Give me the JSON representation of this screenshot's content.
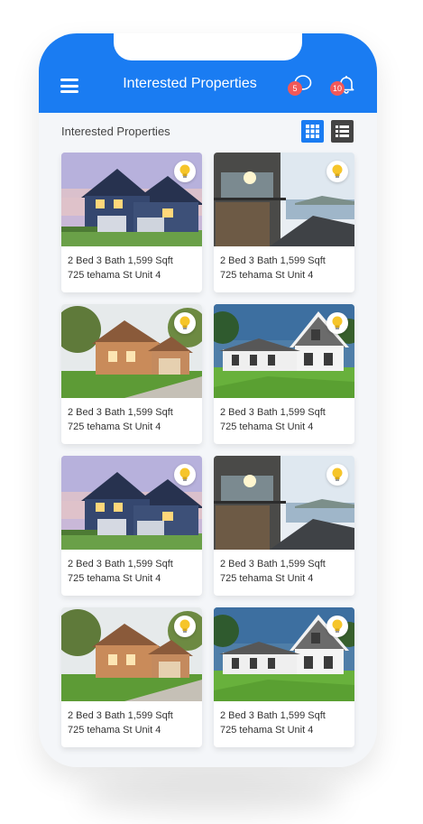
{
  "header": {
    "title": "Interested Properties",
    "chat_badge": "5",
    "bell_badge": "10"
  },
  "section": {
    "title": "Interested Properties"
  },
  "colors": {
    "primary": "#1a7cf2",
    "badge": "#f25858",
    "list_button": "#444444",
    "bulb": "#f6c52a"
  },
  "properties": [
    {
      "details": "2 Bed 3 Bath 1,599 Sqft",
      "address": "725 tehama St Unit 4",
      "photo": "blue-craftsman-house"
    },
    {
      "details": "2 Bed 3 Bath 1,599 Sqft",
      "address": "725 tehama St Unit 4",
      "photo": "lakeside-modern-house"
    },
    {
      "details": "2 Bed 3 Bath 1,599 Sqft",
      "address": "725 tehama St Unit 4",
      "photo": "wooden-cottage-house"
    },
    {
      "details": "2 Bed 3 Bath 1,599 Sqft",
      "address": "725 tehama St Unit 4",
      "photo": "white-farmhouse"
    },
    {
      "details": "2 Bed 3 Bath 1,599 Sqft",
      "address": "725 tehama St Unit 4",
      "photo": "blue-craftsman-house"
    },
    {
      "details": "2 Bed 3 Bath 1,599 Sqft",
      "address": "725 tehama St Unit 4",
      "photo": "lakeside-modern-house"
    },
    {
      "details": "2 Bed 3 Bath 1,599 Sqft",
      "address": "725 tehama St Unit 4",
      "photo": "wooden-cottage-house"
    },
    {
      "details": "2 Bed 3 Bath 1,599 Sqft",
      "address": "725 tehama St Unit 4",
      "photo": "white-farmhouse"
    }
  ]
}
